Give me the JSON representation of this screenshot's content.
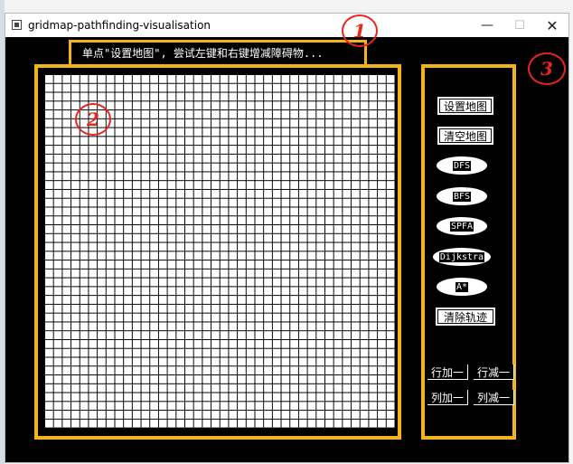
{
  "window": {
    "title": "gridmap-pathfinding-visualisation",
    "controls": {
      "minimize": "—",
      "maximize": "☐",
      "close": "✕"
    }
  },
  "hint_text": "单点\"设置地图\", 尝试左键和右键增减障碍物...",
  "panel": {
    "buttons": [
      {
        "label": "设置地图",
        "style": "rect"
      },
      {
        "label": "清空地图",
        "style": "rect"
      },
      {
        "label": "DFS",
        "style": "oval"
      },
      {
        "label": "BFS",
        "style": "oval"
      },
      {
        "label": "SPFA",
        "style": "oval"
      },
      {
        "label": "Dijkstra",
        "style": "oval"
      },
      {
        "label": "A*",
        "style": "oval"
      },
      {
        "label": "清除轨迹",
        "style": "rect"
      }
    ],
    "row_col": [
      {
        "label": "行加一"
      },
      {
        "label": "行减一"
      },
      {
        "label": "列加一"
      },
      {
        "label": "列减一"
      }
    ]
  },
  "annotations": [
    "1",
    "2",
    "3"
  ],
  "colors": {
    "highlight_border": "#f3b31a",
    "annotation": "#e8251f",
    "canvas_bg": "#000000",
    "grid_cell": "#ffffff"
  }
}
